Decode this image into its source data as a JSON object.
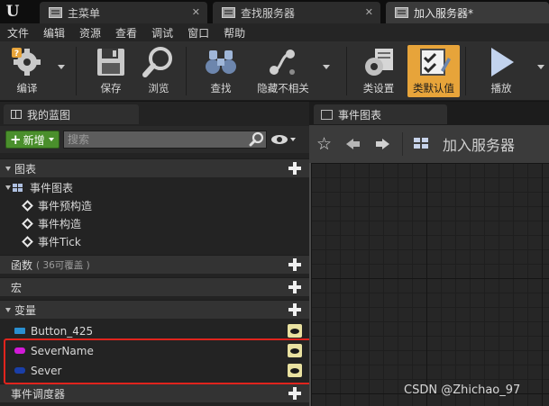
{
  "app": {
    "logo": "U",
    "tabs": [
      {
        "label": "主菜单",
        "icon": "blueprint-icon"
      },
      {
        "label": "查找服务器",
        "icon": "blueprint-icon"
      },
      {
        "label": "加入服务器*",
        "icon": "blueprint-icon",
        "active": true
      }
    ],
    "close_glyph": "✕"
  },
  "menu": [
    "文件",
    "编辑",
    "资源",
    "查看",
    "调试",
    "窗口",
    "帮助"
  ],
  "toolbar": {
    "compile": "编译",
    "save": "保存",
    "browse": "浏览",
    "find": "查找",
    "hide_unrelated": "隐藏不相关",
    "class_settings": "类设置",
    "class_defaults": "类默认值",
    "play": "播放",
    "highlight_color": "#e7a43a"
  },
  "my_blueprint": {
    "tab_label": "我的蓝图",
    "add_button": "新增",
    "search_placeholder": "搜索",
    "sections": {
      "graphs": "图表",
      "event_graph": "事件图表",
      "events": [
        "事件预构造",
        "事件构造",
        "事件Tick"
      ],
      "functions": "函数",
      "functions_note": "( 36可覆盖 )",
      "macros": "宏",
      "variables": "变量",
      "dispatchers": "事件调度器"
    },
    "variables": [
      {
        "name": "Button_425",
        "color": "#2a8fd0"
      },
      {
        "name": "SeverName",
        "color": "#d21ad8"
      },
      {
        "name": "Sever",
        "color": "#1a3fa8"
      }
    ]
  },
  "event_graph_panel": {
    "tab_label": "事件图表",
    "star_glyph": "☆",
    "breadcrumb": "加入服务器"
  },
  "watermark": "CSDN @Zhichao_97"
}
